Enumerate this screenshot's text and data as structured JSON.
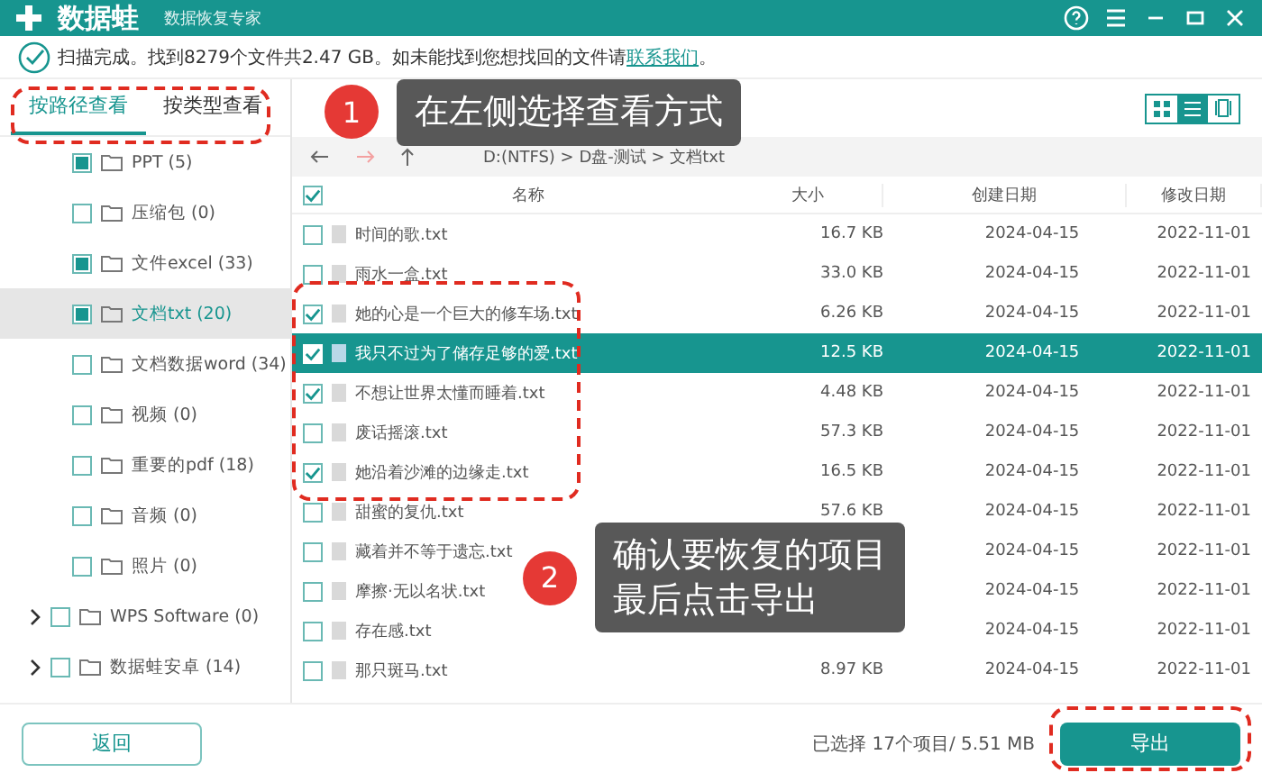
{
  "titlebar": {
    "app_name": "数据蛙",
    "subtitle": "数据恢复专家"
  },
  "scan_notice": {
    "text": "扫描完成。找到8279个文件共2.47 GB。如未能找到您想找回的文件请",
    "link": "联系我们",
    "tail": "。"
  },
  "tabs": [
    {
      "label": "按路径查看",
      "selected": true
    },
    {
      "label": "按类型查看",
      "selected": false
    }
  ],
  "tree_children": [
    {
      "label": "PPT (5)",
      "checked": true,
      "selected": false
    },
    {
      "label": "压缩包 (0)",
      "checked": false,
      "selected": false
    },
    {
      "label": "文件excel (33)",
      "checked": true,
      "selected": false
    },
    {
      "label": "文档txt (20)",
      "checked": true,
      "selected": true
    },
    {
      "label": "文档数据word (34)",
      "checked": false,
      "selected": false
    },
    {
      "label": "视频 (0)",
      "checked": false,
      "selected": false
    },
    {
      "label": "重要的pdf (18)",
      "checked": false,
      "selected": false
    },
    {
      "label": "音频 (0)",
      "checked": false,
      "selected": false
    },
    {
      "label": "照片 (0)",
      "checked": false,
      "selected": false
    }
  ],
  "tree_roots": [
    {
      "label": "WPS Software (0)",
      "expanded": false,
      "checked": false
    },
    {
      "label": "数据蛙安卓 (14)",
      "expanded": false,
      "checked": false
    }
  ],
  "view_modes": [
    {
      "kind": "grid",
      "selected": false
    },
    {
      "kind": "list",
      "selected": true
    },
    {
      "kind": "preview",
      "selected": false
    }
  ],
  "breadcrumb": "D:(NTFS) > D盘-测试 > 文档txt",
  "table": {
    "columns": [
      "名称",
      "大小",
      "创建日期",
      "修改日期"
    ],
    "header_checked": true,
    "rows": [
      {
        "name": "时间的歌.txt",
        "size": "16.7 KB",
        "created": "2024-04-15",
        "modified": "2022-11-01",
        "checked": false,
        "selected": false
      },
      {
        "name": "雨水一盒.txt",
        "size": "33.0 KB",
        "created": "2024-04-15",
        "modified": "2022-11-01",
        "checked": false,
        "selected": false
      },
      {
        "name": "她的心是一个巨大的修车场.txt",
        "size": "6.26 KB",
        "created": "2024-04-15",
        "modified": "2022-11-01",
        "checked": true,
        "selected": false
      },
      {
        "name": "我只不过为了储存足够的爱.txt",
        "size": "12.5 KB",
        "created": "2024-04-15",
        "modified": "2022-11-01",
        "checked": true,
        "selected": true
      },
      {
        "name": "不想让世界太懂而睡着.txt",
        "size": "4.48 KB",
        "created": "2024-04-15",
        "modified": "2022-11-01",
        "checked": true,
        "selected": false
      },
      {
        "name": "废话摇滚.txt",
        "size": "57.3 KB",
        "created": "2024-04-15",
        "modified": "2022-11-01",
        "checked": false,
        "selected": false
      },
      {
        "name": "她沿着沙滩的边缘走.txt",
        "size": "16.5 KB",
        "created": "2024-04-15",
        "modified": "2022-11-01",
        "checked": true,
        "selected": false
      },
      {
        "name": "甜蜜的复仇.txt",
        "size": "57.6 KB",
        "created": "2024-04-15",
        "modified": "2022-11-01",
        "checked": false,
        "selected": false
      },
      {
        "name": "藏着并不等于遗忘.txt",
        "created": "2024-04-15",
        "modified": "2022-11-01",
        "checked": false,
        "selected": false
      },
      {
        "name": "摩擦·无以名状.txt",
        "created": "2024-04-15",
        "modified": "2022-11-01",
        "checked": false,
        "selected": false
      },
      {
        "name": "存在感.txt",
        "created": "2024-04-15",
        "modified": "2022-11-01",
        "checked": false,
        "selected": false
      },
      {
        "name": "那只斑马.txt",
        "size": "8.97 KB",
        "created": "2024-04-15",
        "modified": "2022-11-01",
        "checked": false,
        "selected": false
      }
    ]
  },
  "footer": {
    "back_button": "返回",
    "selection_summary": "已选择 17个项目/ 5.51 MB",
    "export_button": "导出"
  },
  "callouts": [
    {
      "number": "1",
      "lines": [
        "在左侧选择查看方式"
      ]
    },
    {
      "number": "2",
      "lines": [
        "确认要恢复的项目",
        "最后点击导出"
      ]
    }
  ]
}
